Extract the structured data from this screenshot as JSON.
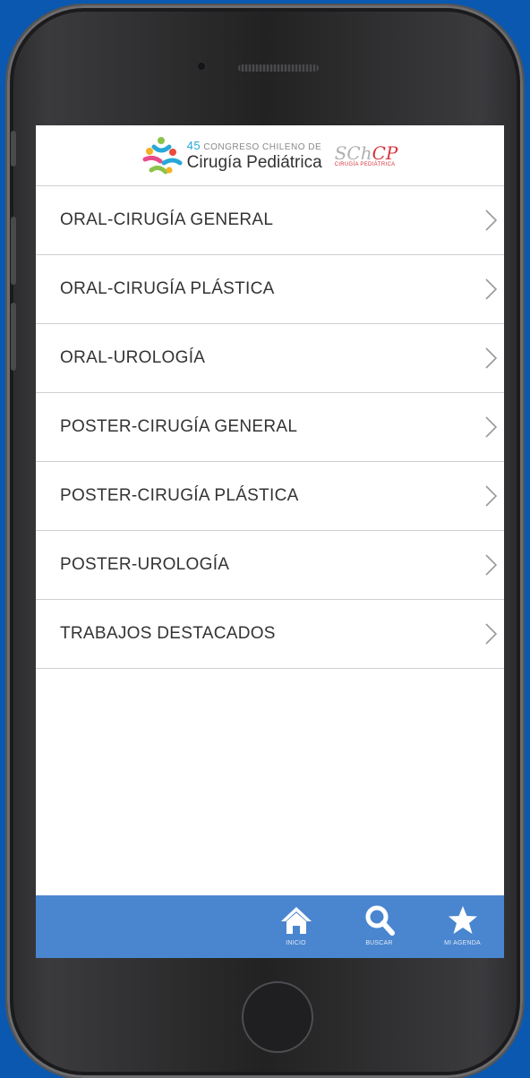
{
  "header": {
    "logo_number": "45",
    "logo_top_text": "CONGRESO CHILENO DE",
    "logo_main_text": "Cirugía Pediátrica",
    "schcp_black": "SCh",
    "schcp_red": "CP",
    "schcp_sub": "CIRUGÍA PEDIÁTRICA"
  },
  "menu": {
    "items": [
      {
        "label": "ORAL-CIRUGÍA GENERAL"
      },
      {
        "label": "ORAL-CIRUGÍA PLÁSTICA"
      },
      {
        "label": "ORAL-UROLOGÍA"
      },
      {
        "label": "POSTER-CIRUGÍA GENERAL"
      },
      {
        "label": "POSTER-CIRUGÍA PLÁSTICA"
      },
      {
        "label": "POSTER-UROLOGÍA"
      },
      {
        "label": "TRABAJOS DESTACADOS"
      }
    ]
  },
  "tabbar": {
    "tabs": [
      {
        "label": "INICIO",
        "icon": "home-icon"
      },
      {
        "label": "BUSCAR",
        "icon": "search-icon"
      },
      {
        "label": "MI AGENDA",
        "icon": "star-icon"
      }
    ]
  },
  "colors": {
    "background": "#0a58b0",
    "tabbar": "#4a86cf",
    "logo_accent": "#28a8d8",
    "brand_red": "#d8343c"
  }
}
